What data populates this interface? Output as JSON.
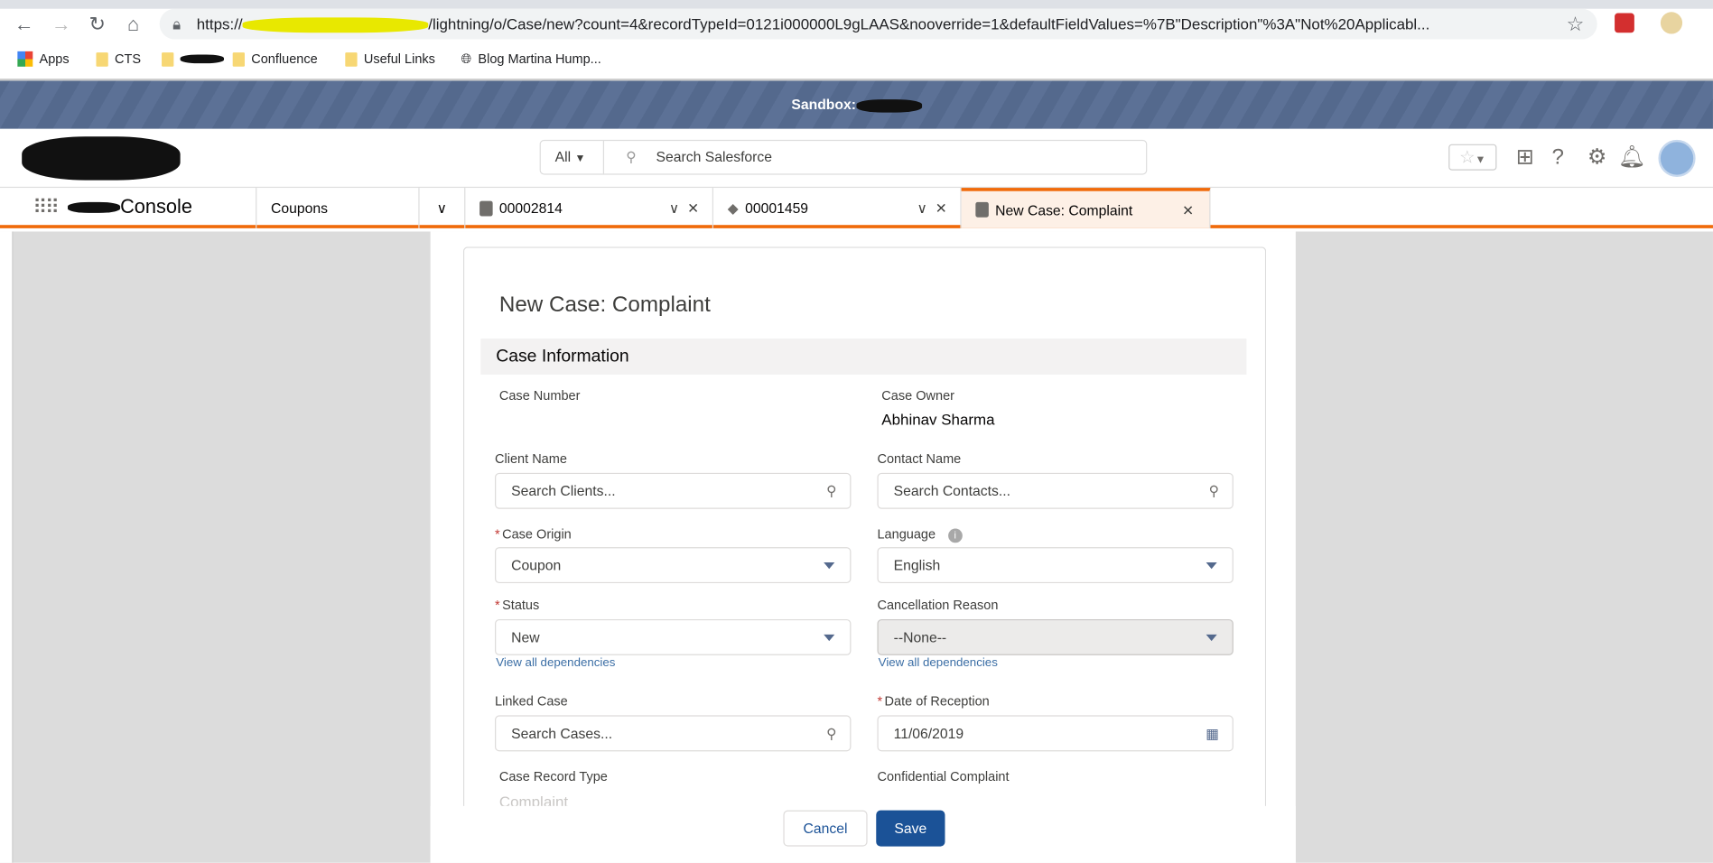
{
  "browser": {
    "url_prefix": "https://",
    "url_rest": "/lightning/o/Case/new?count=4&recordTypeId=0121i000000L9gLAAS&nooverride=1&defaultFieldValues=%7B\"Description\"%3A\"Not%20Applicabl...",
    "bookmarks": [
      "Apps",
      "CTS",
      "Confluence",
      "Useful Links",
      "Blog Martina Hump..."
    ]
  },
  "banner": {
    "label": "Sandbox:"
  },
  "header": {
    "scope": "All",
    "search_placeholder": "Search Salesforce"
  },
  "nav": {
    "app_name": "Console",
    "nav_item": "Coupons",
    "tabs": [
      {
        "label": "00002814"
      },
      {
        "label": "00001459"
      },
      {
        "label": "New Case: Complaint"
      }
    ]
  },
  "form": {
    "title": "New Case: Complaint",
    "section": "Case Information",
    "case_number_label": "Case Number",
    "case_owner_label": "Case Owner",
    "case_owner": "Abhinav Sharma",
    "client_name_label": "Client Name",
    "client_placeholder": "Search Clients...",
    "contact_name_label": "Contact Name",
    "contact_placeholder": "Search Contacts...",
    "case_origin_label": "Case Origin",
    "case_origin": "Coupon",
    "language_label": "Language",
    "language": "English",
    "status_label": "Status",
    "status": "New",
    "cancellation_label": "Cancellation Reason",
    "cancellation": "--None--",
    "dependencies": "View all dependencies",
    "linked_case_label": "Linked Case",
    "linked_case_placeholder": "Search Cases...",
    "date_label": "Date of Reception",
    "date": "11/06/2019",
    "record_type_label": "Case Record Type",
    "record_type": "Complaint",
    "confidential_label": "Confidential Complaint"
  },
  "footer": {
    "cancel": "Cancel",
    "save": "Save"
  }
}
